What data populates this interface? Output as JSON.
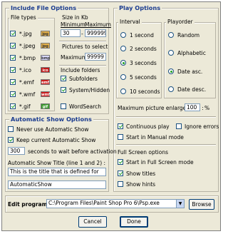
{
  "include": {
    "title": "Include File Options",
    "file_types_label": "File types",
    "types": [
      {
        "label": "*.jpg",
        "checked": true,
        "chip": "jpg",
        "color": "#e8b34a"
      },
      {
        "label": "*.jpeg",
        "checked": true,
        "chip": "jpg",
        "color": "#e8b34a"
      },
      {
        "label": "*.bmp",
        "checked": true,
        "chip": "bmp",
        "color": "#d9d9ff"
      },
      {
        "label": "*.ico",
        "checked": true,
        "chip": "ico",
        "color": "#c01818"
      },
      {
        "label": "*.emf",
        "checked": true,
        "chip": "emf",
        "color": "#cc2020"
      },
      {
        "label": "*.wmf",
        "checked": true,
        "chip": "wmf",
        "color": "#cc2020"
      },
      {
        "label": "*.gif",
        "checked": true,
        "chip": "gif",
        "color": "#3d9b2f"
      }
    ],
    "size_label": "Size in Kb",
    "min_label": "Minimum",
    "max_label": "Maximum",
    "min_value": "30",
    "max_value": "999999",
    "pictures_label": "Pictures to select",
    "maximum_label": "Maximum",
    "pictures_max": "99999",
    "folders_label": "Include folders",
    "subfolders": "Subfolders",
    "system_hidden": "System/Hidden",
    "wordsearch": "WordSearch"
  },
  "play": {
    "title": "Play Options",
    "interval_label": "Interval",
    "intervals": [
      "1 second",
      "2 seconds",
      "3 seconds",
      "5 seconds",
      "10 seconds"
    ],
    "interval_selected": 2,
    "playorder_label": "Playorder",
    "orders": [
      "Random",
      "Alphabetic",
      "Date asc.",
      "Date desc."
    ],
    "order_selected": 2,
    "max_enlarge_label": "Maximum picture enlargement :",
    "max_enlarge_value": "100",
    "percent": "%",
    "continuous": "Continuous play",
    "ignore_errors": "Ignore errors",
    "manual_mode": "Start in Manual mode",
    "fullscreen_label": "Full Screen options",
    "start_fullscreen": "Start in Full Screen mode",
    "show_titles": "Show titles",
    "show_hints": "Show hints"
  },
  "auto": {
    "title": "Automatic Show Options",
    "never_use": "Never use Automatic Show",
    "keep_current": "Keep current  Automatic Show",
    "seconds_value": "300",
    "seconds_label": "seconds to wait before activation",
    "title_label": "Automatic Show Title (line 1 and 2) :",
    "line1": "This is the title that is defined for",
    "line2": "AutomaticShow"
  },
  "edit": {
    "label": "Edit program :",
    "value": "C:\\Program Files\\Paint Shop Pro 6\\Psp.exe",
    "browse": "Browse"
  },
  "buttons": {
    "cancel": "Cancel",
    "done": "Done"
  }
}
